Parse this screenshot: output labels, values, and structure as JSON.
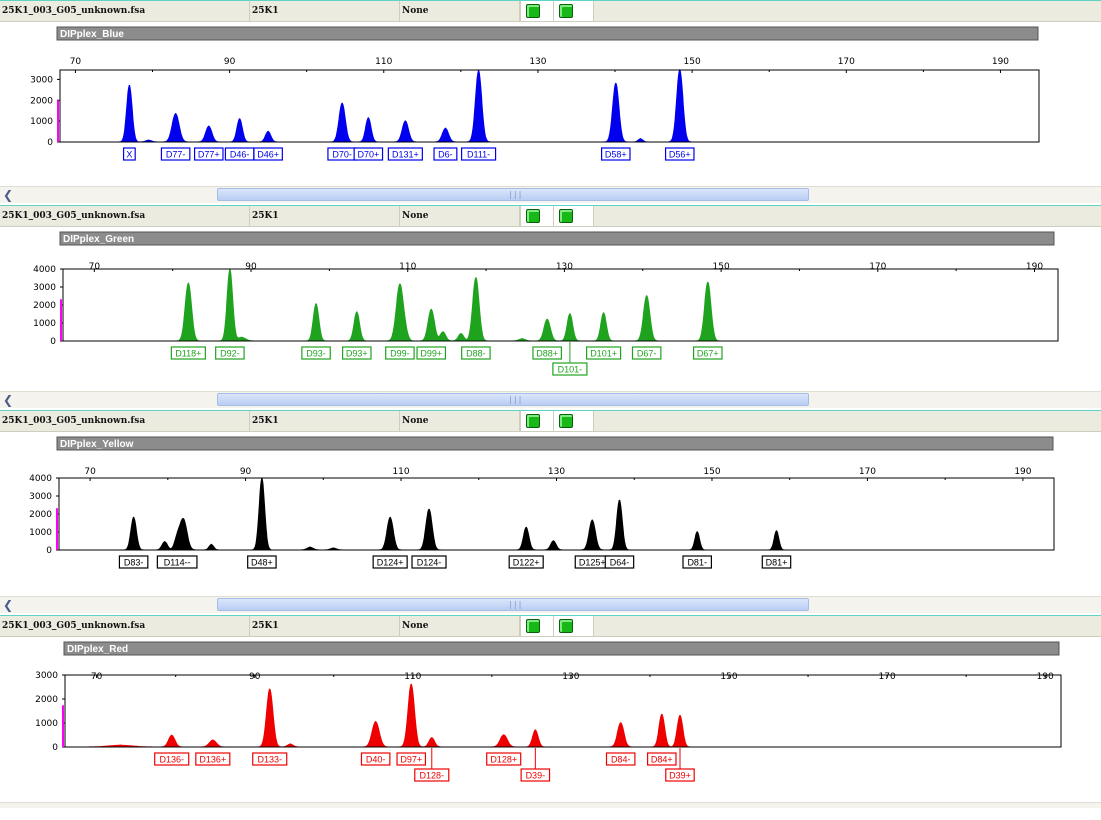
{
  "panels": [
    {
      "file": "25K1_003_G05_unknown.fsa",
      "sample": "25K1",
      "field3": "None",
      "dye": "DIPplex_Blue",
      "color": "#0000ee",
      "scroll_icon": "left-arrow-icon",
      "chart_data": {
        "type": "area",
        "title": "DIPplex_Blue",
        "x_ticks": [
          70,
          90,
          110,
          130,
          150,
          170,
          190
        ],
        "xlim": [
          68,
          195
        ],
        "y_ticks": [
          0,
          1000,
          2000,
          3000
        ],
        "ylim": [
          0,
          3450
        ],
        "grid": false,
        "peaks": [
          {
            "x": 77,
            "height": 2700,
            "width": 0.35
          },
          {
            "x": 83,
            "height": 1350,
            "width": 0.45
          },
          {
            "x": 87.3,
            "height": 750,
            "width": 0.4
          },
          {
            "x": 91.3,
            "height": 1100,
            "width": 0.35
          },
          {
            "x": 95,
            "height": 500,
            "width": 0.35
          },
          {
            "x": 104.6,
            "height": 1850,
            "width": 0.4
          },
          {
            "x": 108,
            "height": 1150,
            "width": 0.35
          },
          {
            "x": 112.8,
            "height": 1000,
            "width": 0.4
          },
          {
            "x": 118,
            "height": 650,
            "width": 0.4
          },
          {
            "x": 122.3,
            "height": 3400,
            "width": 0.4
          },
          {
            "x": 140.1,
            "height": 2800,
            "width": 0.4
          },
          {
            "x": 148.4,
            "height": 3450,
            "width": 0.4
          },
          {
            "x": 143.3,
            "height": 150,
            "width": 0.3
          },
          {
            "x": 79.5,
            "height": 80,
            "width": 0.4
          }
        ],
        "labels": [
          {
            "text": "X",
            "x": 77
          },
          {
            "text": "D77-",
            "x": 83
          },
          {
            "text": "D77+",
            "x": 87.3
          },
          {
            "text": "D46-",
            "x": 91.3
          },
          {
            "text": "D46+",
            "x": 95
          },
          {
            "text": "D70-",
            "x": 104.6
          },
          {
            "text": "D70+",
            "x": 108
          },
          {
            "text": "D131+",
            "x": 112.8
          },
          {
            "text": "D6-",
            "x": 118
          },
          {
            "text": "D111-",
            "x": 122.3
          },
          {
            "text": "D58+",
            "x": 140.1
          },
          {
            "text": "D56+",
            "x": 148.4
          }
        ]
      }
    },
    {
      "file": "25K1_003_G05_unknown.fsa",
      "sample": "25K1",
      "field3": "None",
      "dye": "DIPplex_Green",
      "color": "#1fa31f",
      "scroll_icon": "left-arrow-icon",
      "chart_data": {
        "type": "area",
        "title": "DIPplex_Green",
        "x_ticks": [
          70,
          90,
          110,
          130,
          150,
          170,
          190
        ],
        "xlim": [
          66,
          193
        ],
        "y_ticks": [
          0,
          1000,
          2000,
          3000,
          4000
        ],
        "ylim": [
          0,
          4000
        ],
        "grid": false,
        "peaks": [
          {
            "x": 82,
            "height": 3200,
            "width": 0.4
          },
          {
            "x": 87.3,
            "height": 3950,
            "width": 0.35
          },
          {
            "x": 98.3,
            "height": 2050,
            "width": 0.35
          },
          {
            "x": 103.5,
            "height": 1600,
            "width": 0.35
          },
          {
            "x": 109,
            "height": 3150,
            "width": 0.45
          },
          {
            "x": 113,
            "height": 1750,
            "width": 0.4
          },
          {
            "x": 114.5,
            "height": 500,
            "width": 0.35
          },
          {
            "x": 118.7,
            "height": 3500,
            "width": 0.4
          },
          {
            "x": 116.8,
            "height": 400,
            "width": 0.35
          },
          {
            "x": 127.8,
            "height": 1200,
            "width": 0.4
          },
          {
            "x": 130.7,
            "height": 1500,
            "width": 0.35
          },
          {
            "x": 135,
            "height": 1550,
            "width": 0.35
          },
          {
            "x": 140.5,
            "height": 2500,
            "width": 0.4
          },
          {
            "x": 148.3,
            "height": 3250,
            "width": 0.4
          },
          {
            "x": 88.8,
            "height": 200,
            "width": 0.5
          },
          {
            "x": 124.6,
            "height": 120,
            "width": 0.4
          },
          {
            "x": 109.8,
            "height": 220,
            "width": 0.3
          }
        ],
        "labels": [
          {
            "text": "D118+",
            "x": 82
          },
          {
            "text": "D92-",
            "x": 87.3
          },
          {
            "text": "D93-",
            "x": 98.3
          },
          {
            "text": "D93+",
            "x": 103.5
          },
          {
            "text": "D99-",
            "x": 109
          },
          {
            "text": "D99+",
            "x": 113
          },
          {
            "text": "D88-",
            "x": 118.7
          },
          {
            "text": "D88+",
            "x": 127.8
          },
          {
            "text": "D101+",
            "x": 135
          },
          {
            "text": "D67-",
            "x": 140.5
          },
          {
            "text": "D67+",
            "x": 148.3
          },
          {
            "text": "D101-",
            "x": 130.7,
            "row": 2
          }
        ]
      }
    },
    {
      "file": "25K1_003_G05_unknown.fsa",
      "sample": "25K1",
      "field3": "None",
      "dye": "DIPplex_Yellow",
      "color": "#000000",
      "scroll_icon": "left-arrow-icon",
      "chart_data": {
        "type": "area",
        "title": "DIPplex_Yellow",
        "x_ticks": [
          70,
          90,
          110,
          130,
          150,
          170,
          190
        ],
        "xlim": [
          66,
          194
        ],
        "y_ticks": [
          0,
          1000,
          2000,
          3000,
          4000
        ],
        "ylim": [
          0,
          4000
        ],
        "grid": false,
        "peaks": [
          {
            "x": 75.6,
            "height": 1800,
            "width": 0.35
          },
          {
            "x": 79.6,
            "height": 450,
            "width": 0.35
          },
          {
            "x": 82,
            "height": 1700,
            "width": 0.45
          },
          {
            "x": 81.2,
            "height": 600,
            "width": 0.35
          },
          {
            "x": 85.6,
            "height": 300,
            "width": 0.3
          },
          {
            "x": 92.1,
            "height": 3950,
            "width": 0.35
          },
          {
            "x": 108.6,
            "height": 1800,
            "width": 0.4
          },
          {
            "x": 113.6,
            "height": 2250,
            "width": 0.4
          },
          {
            "x": 126.1,
            "height": 1250,
            "width": 0.35
          },
          {
            "x": 129.6,
            "height": 500,
            "width": 0.35
          },
          {
            "x": 134.6,
            "height": 1650,
            "width": 0.4
          },
          {
            "x": 138.1,
            "height": 2750,
            "width": 0.35
          },
          {
            "x": 148.1,
            "height": 1000,
            "width": 0.3
          },
          {
            "x": 158.3,
            "height": 1050,
            "width": 0.3
          },
          {
            "x": 98.3,
            "height": 150,
            "width": 0.4
          },
          {
            "x": 101.3,
            "height": 100,
            "width": 0.4
          }
        ],
        "labels": [
          {
            "text": "D83-",
            "x": 75.6
          },
          {
            "text": "D114--",
            "x": 81.2
          },
          {
            "text": "D48+",
            "x": 92.1
          },
          {
            "text": "D124+",
            "x": 108.6
          },
          {
            "text": "D124-",
            "x": 113.6
          },
          {
            "text": "D122+",
            "x": 126.1
          },
          {
            "text": "D125+",
            "x": 134.6
          },
          {
            "text": "D64-",
            "x": 138.1
          },
          {
            "text": "D81-",
            "x": 148.1
          },
          {
            "text": "D81+",
            "x": 158.3
          }
        ]
      }
    },
    {
      "file": "25K1_003_G05_unknown.fsa",
      "sample": "25K1",
      "field3": "None",
      "dye": "DIPplex_Red",
      "color": "#ee0000",
      "scroll_icon": "left-arrow-icon",
      "chart_data": {
        "type": "area",
        "title": "DIPplex_Red",
        "x_ticks": [
          70,
          90,
          110,
          130,
          150,
          170,
          190
        ],
        "xlim": [
          66,
          192
        ],
        "y_ticks": [
          0,
          1000,
          2000,
          3000
        ],
        "ylim": [
          0,
          3000
        ],
        "grid": false,
        "peaks": [
          {
            "x": 79.5,
            "height": 480,
            "width": 0.4
          },
          {
            "x": 84.7,
            "height": 280,
            "width": 0.45
          },
          {
            "x": 91.9,
            "height": 2400,
            "width": 0.4
          },
          {
            "x": 105.3,
            "height": 1050,
            "width": 0.45
          },
          {
            "x": 109.8,
            "height": 2600,
            "width": 0.4
          },
          {
            "x": 112.4,
            "height": 380,
            "width": 0.35
          },
          {
            "x": 121.5,
            "height": 500,
            "width": 0.45
          },
          {
            "x": 125.5,
            "height": 700,
            "width": 0.35
          },
          {
            "x": 136.3,
            "height": 1000,
            "width": 0.4
          },
          {
            "x": 141.5,
            "height": 1350,
            "width": 0.35
          },
          {
            "x": 143.8,
            "height": 1300,
            "width": 0.35
          },
          {
            "x": 94.5,
            "height": 120,
            "width": 0.35
          },
          {
            "x": 73,
            "height": 70,
            "width": 1.5
          }
        ],
        "labels": [
          {
            "text": "D136-",
            "x": 79.5
          },
          {
            "text": "D136+",
            "x": 84.7
          },
          {
            "text": "D133-",
            "x": 91.9
          },
          {
            "text": "D40-",
            "x": 105.3
          },
          {
            "text": "D97+",
            "x": 109.8
          },
          {
            "text": "D128+",
            "x": 121.5
          },
          {
            "text": "D84-",
            "x": 136.3
          },
          {
            "text": "D84+",
            "x": 141.5
          },
          {
            "text": "D128-",
            "x": 112.4,
            "row": 2
          },
          {
            "text": "D39-",
            "x": 125.5,
            "row": 2
          },
          {
            "text": "D39+",
            "x": 143.8,
            "row": 2
          }
        ]
      }
    }
  ]
}
